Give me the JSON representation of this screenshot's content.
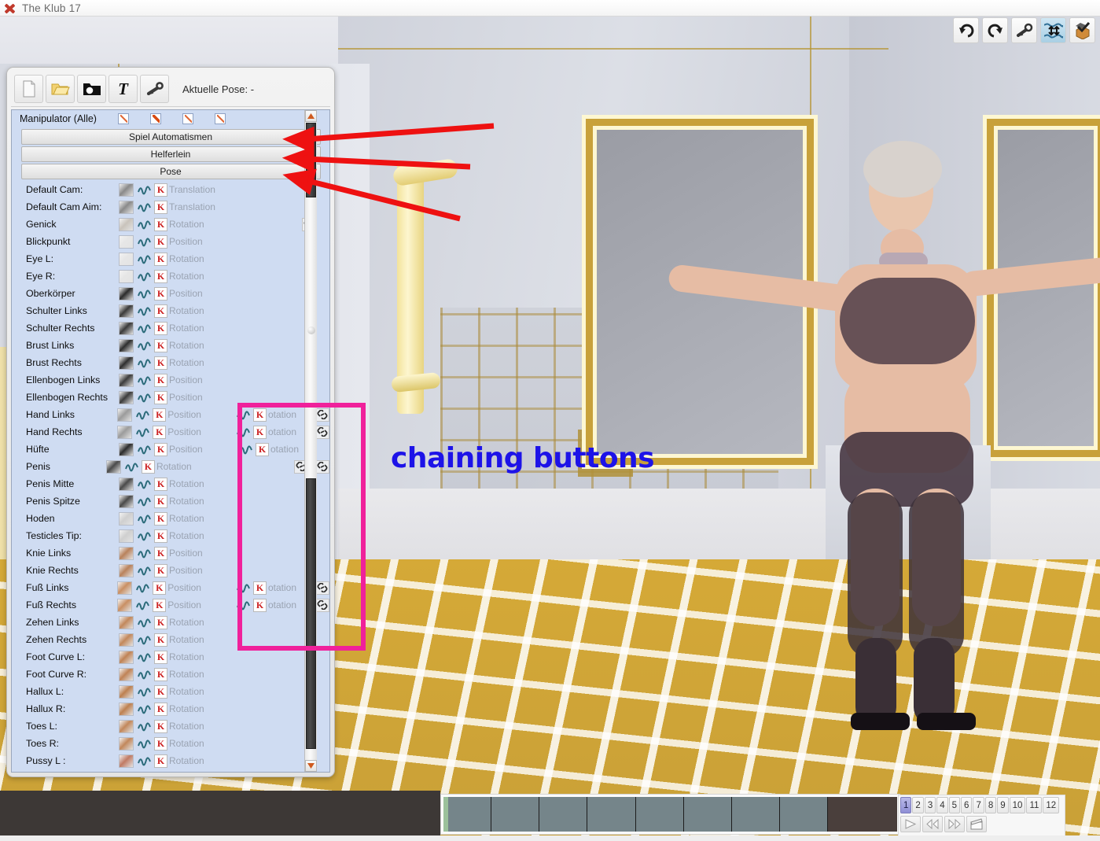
{
  "window": {
    "title": "The Klub 17",
    "logo_icon": "app-x-logo-icon"
  },
  "top_toolbar": {
    "buttons": [
      {
        "name": "undo",
        "icon": "undo-arrow-icon"
      },
      {
        "name": "redo",
        "icon": "redo-arrow-icon"
      },
      {
        "name": "key",
        "icon": "key-icon"
      },
      {
        "name": "water-level",
        "icon": "water-level-icon"
      },
      {
        "name": "box",
        "icon": "box-check-icon"
      }
    ]
  },
  "pose_panel": {
    "toolbar": {
      "buttons": [
        {
          "name": "new",
          "icon": "new-document-icon"
        },
        {
          "name": "open",
          "icon": "open-folder-icon"
        },
        {
          "name": "save",
          "icon": "black-folder-icon"
        },
        {
          "name": "text",
          "icon": "text-T-icon"
        },
        {
          "name": "key",
          "icon": "key-icon"
        }
      ],
      "pose_label": "Aktuelle Pose: -"
    },
    "manipulator_row": {
      "label": "Manipulator (Alle)",
      "checkboxes": [
        true,
        true,
        true,
        true
      ]
    },
    "section_buttons": [
      {
        "label": "Spiel Automatismen"
      },
      {
        "label": "Helferlein"
      },
      {
        "label": "Pose"
      }
    ],
    "rows": [
      {
        "name": "Default Cam:",
        "thumb": "camera-icon",
        "type": "Translation",
        "chain": false,
        "col2": null
      },
      {
        "name": "Default Cam Aim:",
        "thumb": "camera-icon",
        "type": "Translation",
        "chain": false,
        "col2": null
      },
      {
        "name": "Genick",
        "thumb": "neck-icon",
        "type": "Rotation",
        "chain": true,
        "col2": null
      },
      {
        "name": "Blickpunkt",
        "thumb": "eye-icon",
        "type": "Position",
        "chain": false,
        "col2": null
      },
      {
        "name": "Eye L:",
        "thumb": "eye-icon",
        "type": "Rotation",
        "chain": false,
        "col2": null
      },
      {
        "name": "Eye R:",
        "thumb": "eye-icon",
        "type": "Rotation",
        "chain": false,
        "col2": null
      },
      {
        "name": "Oberkörper",
        "thumb": "torso-icon",
        "type": "Position",
        "chain": false,
        "col2": null
      },
      {
        "name": "Schulter Links",
        "thumb": "shoulder-icon",
        "type": "Rotation",
        "chain": false,
        "col2": null
      },
      {
        "name": "Schulter Rechts",
        "thumb": "shoulder-icon",
        "type": "Rotation",
        "chain": false,
        "col2": null
      },
      {
        "name": "Brust Links",
        "thumb": "chest-icon",
        "type": "Rotation",
        "chain": false,
        "col2": null
      },
      {
        "name": "Brust Rechts",
        "thumb": "chest-icon",
        "type": "Rotation",
        "chain": false,
        "col2": null
      },
      {
        "name": "Ellenbogen Links",
        "thumb": "elbow-icon",
        "type": "Position",
        "chain": false,
        "col2": null
      },
      {
        "name": "Ellenbogen Rechts",
        "thumb": "elbow-icon",
        "type": "Position",
        "chain": false,
        "col2": null
      },
      {
        "name": "Hand Links",
        "thumb": "hand-icon",
        "type": "Position",
        "chain": false,
        "col2": {
          "type": "otation",
          "chain": true
        }
      },
      {
        "name": "Hand Rechts",
        "thumb": "hand-icon",
        "type": "Position",
        "chain": false,
        "col2": {
          "type": "otation",
          "chain": true
        }
      },
      {
        "name": "Hüfte",
        "thumb": "hip-icon",
        "type": "Position",
        "chain": false,
        "col2": {
          "type": "otation",
          "chain": false
        }
      },
      {
        "name": "Penis",
        "thumb": "penis-icon",
        "type": "Rotation",
        "chain": false,
        "col2": {
          "type": "",
          "chain": true,
          "chain2": true
        }
      },
      {
        "name": "Penis Mitte",
        "thumb": "penis-icon",
        "type": "Rotation",
        "chain": false,
        "col2": null
      },
      {
        "name": "Penis Spitze",
        "thumb": "penis-icon",
        "type": "Rotation",
        "chain": false,
        "col2": null
      },
      {
        "name": "Hoden",
        "thumb": "testicles-icon",
        "type": "Rotation",
        "chain": false,
        "col2": null
      },
      {
        "name": "Testicles Tip:",
        "thumb": "testicles-icon",
        "type": "Rotation",
        "chain": false,
        "col2": null
      },
      {
        "name": "Knie Links",
        "thumb": "knee-icon",
        "type": "Position",
        "chain": false,
        "col2": null
      },
      {
        "name": "Knie Rechts",
        "thumb": "knee-icon",
        "type": "Position",
        "chain": false,
        "col2": null
      },
      {
        "name": "Fuß Links",
        "thumb": "foot-icon",
        "type": "Position",
        "chain": false,
        "col2": {
          "type": "otation",
          "chain": true
        }
      },
      {
        "name": "Fuß Rechts",
        "thumb": "foot-icon",
        "type": "Position",
        "chain": false,
        "col2": {
          "type": "otation",
          "chain": true
        }
      },
      {
        "name": "Zehen Links",
        "thumb": "toes-icon",
        "type": "Rotation",
        "chain": false,
        "col2": null
      },
      {
        "name": "Zehen Rechts",
        "thumb": "toes-icon",
        "type": "Rotation",
        "chain": false,
        "col2": null
      },
      {
        "name": "Foot Curve L:",
        "thumb": "foot-curve-icon",
        "type": "Rotation",
        "chain": false,
        "col2": null
      },
      {
        "name": "Foot Curve R:",
        "thumb": "foot-curve-icon",
        "type": "Rotation",
        "chain": false,
        "col2": null
      },
      {
        "name": "Hallux L:",
        "thumb": "hallux-icon",
        "type": "Rotation",
        "chain": false,
        "col2": null
      },
      {
        "name": "Hallux R:",
        "thumb": "hallux-icon",
        "type": "Rotation",
        "chain": false,
        "col2": null
      },
      {
        "name": "Toes L:",
        "thumb": "toes-icon",
        "type": "Rotation",
        "chain": false,
        "col2": null
      },
      {
        "name": "Toes R:",
        "thumb": "toes-icon",
        "type": "Rotation",
        "chain": false,
        "col2": null
      },
      {
        "name": "Pussy L :",
        "thumb": "pussy-icon",
        "type": "Rotation",
        "chain": false,
        "col2": null
      }
    ]
  },
  "annotations": {
    "chaining_label": "chaining buttons",
    "chaining_label_color": "#1d13e8",
    "highlight_box_color": "#f0219b",
    "arrow_color": "#ee1111",
    "arrow_count": 3
  },
  "timeline": {
    "cell_count": 8,
    "frames": [
      "1",
      "2",
      "3",
      "4",
      "5",
      "6",
      "7",
      "8",
      "9",
      "10",
      "11",
      "12"
    ],
    "active_frame": "1",
    "transport": [
      {
        "name": "play",
        "icon": "play-icon"
      },
      {
        "name": "prev",
        "icon": "rewind-icon"
      },
      {
        "name": "next",
        "icon": "fast-forward-icon"
      },
      {
        "name": "clapper",
        "icon": "clapperboard-icon"
      }
    ]
  }
}
